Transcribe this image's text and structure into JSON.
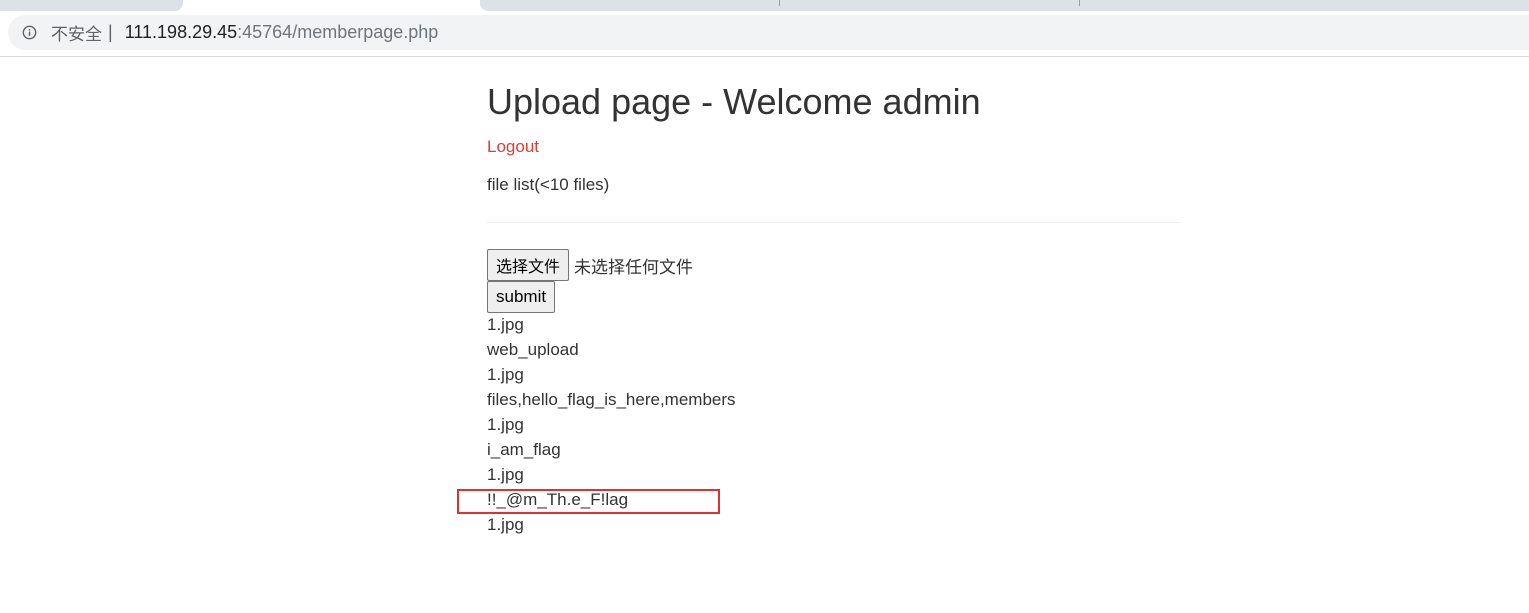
{
  "browser": {
    "security_label": "不安全",
    "divider": "|",
    "url_host": "111.198.29.45",
    "url_rest": ":45764/memberpage.php"
  },
  "page": {
    "title": "Upload page - Welcome admin",
    "logout_label": "Logout",
    "file_list_title": "file list(<10 files)",
    "choose_file_label": "选择文件",
    "no_file_chosen": "未选择任何文件",
    "submit_label": "submit",
    "files": [
      "1.jpg",
      "web_upload",
      "1.jpg",
      "files,hello_flag_is_here,members",
      "1.jpg",
      "i_am_flag",
      "1.jpg",
      "!!_@m_Th.e_F!lag",
      "1.jpg"
    ]
  },
  "colors": {
    "logout": "#e03c31",
    "highlight": "#e2312d"
  }
}
